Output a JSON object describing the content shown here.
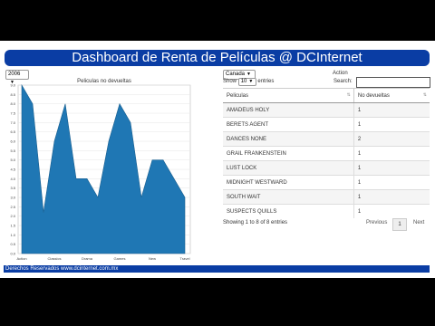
{
  "header": {
    "title": "Dashboard de Renta de Películas @ DCInternet"
  },
  "year_select": {
    "value": "2006"
  },
  "country_select": {
    "value": "Canada"
  },
  "action_label": "Action",
  "chart_data": {
    "type": "area",
    "title": "Peliculas no devueltas",
    "ylim": [
      0,
      9
    ],
    "y_ticks": [
      "0.0",
      "0.5",
      "1.0",
      "1.5",
      "2.0",
      "2.5",
      "3.0",
      "3.5",
      "4.0",
      "4.5",
      "5.0",
      "5.5",
      "6.0",
      "6.5",
      "7.0",
      "7.5",
      "8.0",
      "8.5",
      "9.0"
    ],
    "x_ticks": [
      "Action",
      "Classics",
      "Drama",
      "Games",
      "New",
      "Travel"
    ],
    "values": [
      9,
      8,
      2.2,
      6,
      8,
      4,
      4,
      3,
      6,
      8,
      7,
      3,
      5,
      5,
      4,
      3
    ],
    "color": "#1f77b4"
  },
  "table": {
    "show_label": "Show",
    "entries_value": "10",
    "entries_label": "entries",
    "search_label": "Search:",
    "columns": [
      "Peliculas",
      "No devueltas"
    ],
    "rows": [
      {
        "title": "AMADEUS HOLY",
        "count": "1"
      },
      {
        "title": "BERETS AGENT",
        "count": "1"
      },
      {
        "title": "DANCES NONE",
        "count": "2"
      },
      {
        "title": "GRAIL FRANKENSTEIN",
        "count": "1"
      },
      {
        "title": "LUST LOCK",
        "count": "1"
      },
      {
        "title": "MIDNIGHT WESTWARD",
        "count": "1"
      },
      {
        "title": "SOUTH WAIT",
        "count": "1"
      },
      {
        "title": "SUSPECTS QUILLS",
        "count": "1"
      }
    ],
    "info": "Showing 1 to 8 of 8 entries",
    "pager": {
      "previous": "Previous",
      "current": "1",
      "next": "Next"
    }
  },
  "footer": {
    "text": "Derechos Reservados www.dcinternet.com.mx"
  }
}
